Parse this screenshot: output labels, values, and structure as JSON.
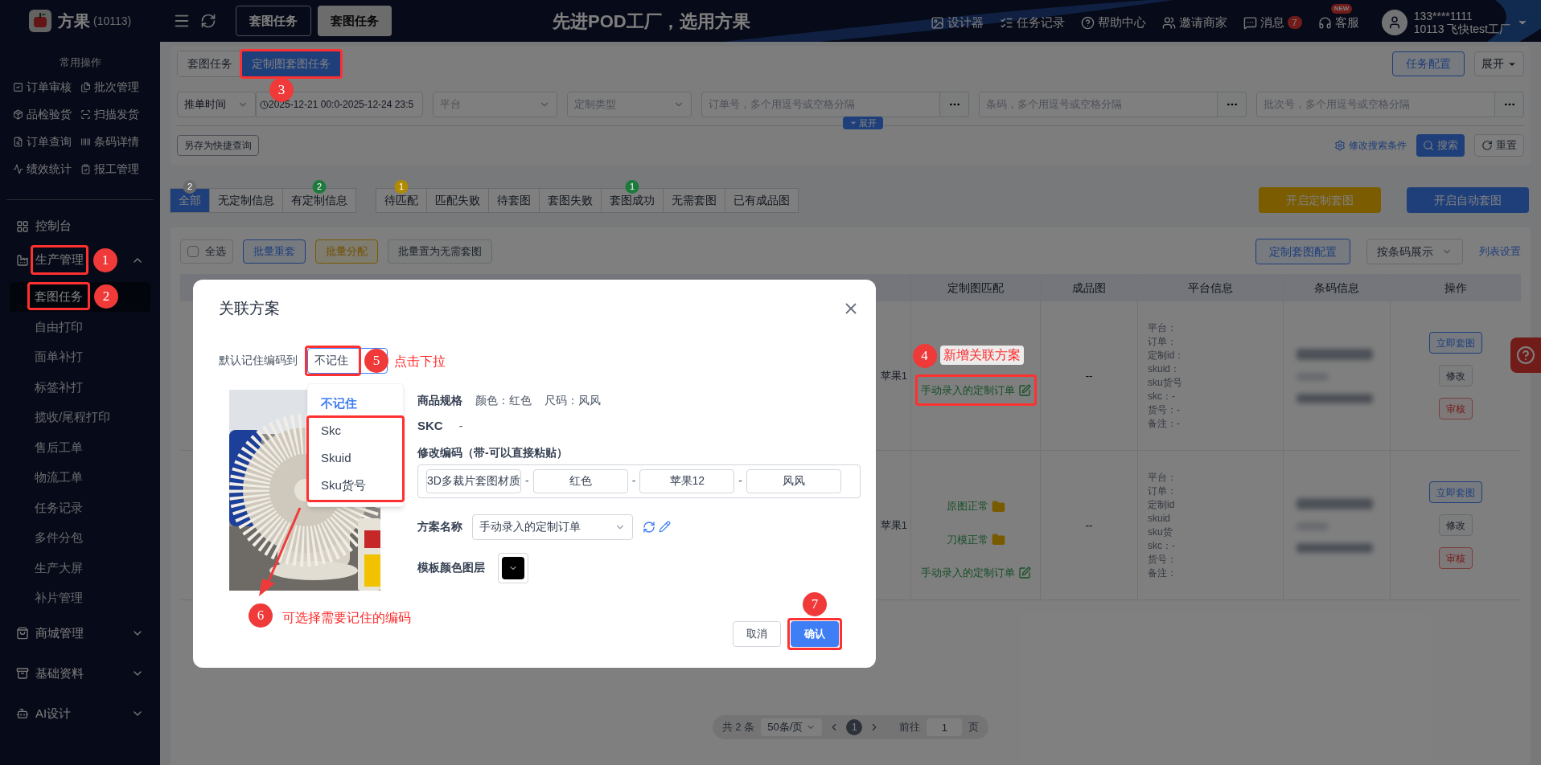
{
  "topbar": {
    "logo": {
      "name": "方果",
      "code": "(10113)"
    },
    "tabs": [
      {
        "label": "套图任务",
        "selected": false
      },
      {
        "label": "套图任务",
        "selected": true
      }
    ],
    "slogan": "先进POD工厂，选用方果",
    "links": [
      {
        "label": "设计器"
      },
      {
        "label": "任务记录",
        "kind": "list"
      },
      {
        "label": "帮助中心",
        "kind": "help"
      },
      {
        "label": "邀请商家",
        "kind": "users"
      },
      {
        "label": "消息",
        "kind": "message",
        "badge": "7"
      },
      {
        "label": "客服",
        "kind": "service",
        "tag": "NEW"
      }
    ],
    "user": {
      "phone": "133****1111",
      "org": "10113 飞快test工厂"
    }
  },
  "sidebar": {
    "quick_title": "常用操作",
    "quick": [
      {
        "label": "订单审核",
        "kind": "check"
      },
      {
        "label": "批次管理",
        "kind": "batch"
      },
      {
        "label": "品检验货",
        "kind": "inspect"
      },
      {
        "label": "扫描发货",
        "kind": "scan"
      },
      {
        "label": "订单查询",
        "kind": "query"
      },
      {
        "label": "条码详情",
        "kind": "barcode"
      },
      {
        "label": "绩效统计",
        "kind": "stats"
      },
      {
        "label": "报工管理",
        "kind": "report"
      }
    ],
    "menu": [
      {
        "label": "控制台",
        "kind": "dashboard"
      },
      {
        "label": "生产管理",
        "kind": "factory",
        "expanded": true,
        "children": [
          {
            "label": "套图任务",
            "selected": true
          },
          {
            "label": "自由打印",
            "selected": false
          },
          {
            "label": "面单补打",
            "selected": false
          },
          {
            "label": "标签补打",
            "selected": false
          },
          {
            "label": "揽收/尾程打印",
            "selected": false
          },
          {
            "label": "售后工单",
            "selected": false
          },
          {
            "label": "物流工单",
            "selected": false
          },
          {
            "label": "任务记录",
            "selected": false
          },
          {
            "label": "多件分包",
            "selected": false
          },
          {
            "label": "生产大屏",
            "selected": false
          },
          {
            "label": "补片管理",
            "selected": false
          }
        ]
      },
      {
        "label": "商城管理",
        "kind": "shop",
        "expanded": false
      },
      {
        "label": "基础资料",
        "kind": "archive",
        "expanded": false
      },
      {
        "label": "AI设计",
        "kind": "ai",
        "expanded": false
      }
    ]
  },
  "page_tabs": [
    {
      "label": "套图任务",
      "selected": false
    },
    {
      "label": "定制图套图任务",
      "selected": true
    }
  ],
  "config_button": "任务配置",
  "expand_button": "展开",
  "filters": [
    {
      "kind": "select",
      "value": "推单时间"
    },
    {
      "kind": "daterange",
      "start": "2025-12-21 00:0",
      "separator": "-",
      "end": "2025-12-24 23:5"
    },
    {
      "kind": "select",
      "placeholder": "平台"
    },
    {
      "kind": "select",
      "placeholder": "定制类型"
    },
    {
      "kind": "multi",
      "placeholder": "订单号，多个用逗号或空格分隔"
    },
    {
      "kind": "multi",
      "placeholder": "条码，多个用逗号或空格分隔"
    },
    {
      "kind": "multi",
      "placeholder": "批次号，多个用逗号或空格分隔"
    }
  ],
  "save_query": "另存为快捷查询",
  "expand_tag": "展开",
  "edit_conditions": "修改搜索条件",
  "search": "搜索",
  "reset": "重置",
  "status_groups": [
    {
      "tabs": [
        {
          "label": "全部",
          "selected": true,
          "badge": "2",
          "color": "#6b6b6b"
        },
        {
          "label": "无定制信息",
          "selected": false
        },
        {
          "label": "有定制信息",
          "selected": false,
          "badge": "2",
          "color": "#1d7a3c"
        }
      ]
    },
    {
      "tabs": [
        {
          "label": "待匹配",
          "selected": false,
          "badge": "1",
          "color": "#b08a00"
        },
        {
          "label": "匹配失败",
          "selected": false
        },
        {
          "label": "待套图",
          "selected": false
        },
        {
          "label": "套图失败",
          "selected": false
        },
        {
          "label": "套图成功",
          "selected": false,
          "badge": "1",
          "color": "#1d7a3c"
        },
        {
          "label": "无需套图",
          "selected": false
        },
        {
          "label": "已有成品图",
          "selected": false
        }
      ]
    }
  ],
  "actions": [
    {
      "label": "开启定制套图",
      "kind": "warning"
    },
    {
      "label": "开启自动套图",
      "kind": "primary"
    }
  ],
  "toolbar": {
    "select_all": {
      "label": "全选",
      "checked": false
    },
    "batch": [
      {
        "label": "批量重套",
        "kind": "primary"
      },
      {
        "label": "批量分配",
        "kind": "warning"
      },
      {
        "label": "批量置为无需套图",
        "kind": "default"
      }
    ],
    "config": "定制套图配置",
    "view": "按条码展示",
    "columns_link": "列表设置"
  },
  "table": {
    "columns": [
      "定制图匹配",
      "成品图",
      "平台信息",
      "条码信息",
      "操作"
    ],
    "rows": [
      {
        "code_tail": "苹果1",
        "matches": [
          {
            "label": "手动录入的定制订单",
            "kind": "edit"
          }
        ],
        "product_image": "--",
        "platform": [
          "平台：",
          "订单：",
          "定制id：",
          "skuid：",
          "sku货号",
          "skc：-",
          "货号：-",
          "备注：-"
        ],
        "actions": [
          {
            "label": "立即套图",
            "kind": "primary"
          },
          {
            "label": "修改",
            "kind": "default"
          },
          {
            "label": "审核",
            "kind": "danger"
          }
        ]
      },
      {
        "code_tail": "苹果1",
        "matches": [
          {
            "label": "原图正常",
            "kind": "folder"
          },
          {
            "label": "刀模正常",
            "kind": "folder"
          },
          {
            "label": "手动录入的定制订单",
            "kind": "edit"
          }
        ],
        "product_image": "--",
        "platform": [
          "平台：",
          "订单：",
          "定制id",
          "skuid",
          "sku货",
          "skc：-",
          "货号：",
          "备注："
        ],
        "actions": [
          {
            "label": "立即套图",
            "kind": "primary"
          },
          {
            "label": "修改",
            "kind": "default"
          },
          {
            "label": "审核",
            "kind": "danger"
          }
        ]
      }
    ]
  },
  "pagination": {
    "total": "共 2 条",
    "page_size": "50条/页",
    "pages": [
      {
        "label": "1",
        "selected": true
      }
    ],
    "goto_label": "前往",
    "goto_value": "1",
    "goto_suffix": "页"
  },
  "modal": {
    "title": "关联方案",
    "remember_label": "默认记住编码到",
    "remember_value": "不记住",
    "options": [
      {
        "label": "不记住",
        "selected": true
      },
      {
        "label": "Skc",
        "selected": false
      },
      {
        "label": "Skuid",
        "selected": false
      },
      {
        "label": "Sku货号",
        "selected": false
      }
    ],
    "spec_label": "商品规格",
    "spec": [
      "颜色：红色",
      "尺码：风风"
    ],
    "skc_label": "SKC",
    "skc_value": "-",
    "code_label": "修改编码（带-可以直接粘贴）",
    "code_segments": [
      {
        "kind": "input",
        "value": "3D多裁片套图材质"
      },
      {
        "kind": "separator",
        "text": "-"
      },
      {
        "kind": "input",
        "value": "红色"
      },
      {
        "kind": "separator",
        "text": "-"
      },
      {
        "kind": "input",
        "value": "苹果12"
      },
      {
        "kind": "separator",
        "text": "-"
      },
      {
        "kind": "input",
        "value": "风风"
      }
    ],
    "scheme_label": "方案名称",
    "scheme_value": "手动录入的定制订单",
    "color_layer_label": "模板颜色图层",
    "color_layer": {
      "color": "#000000"
    },
    "buttons": [
      {
        "label": "取消",
        "kind": "default"
      },
      {
        "label": "确认",
        "kind": "primary"
      }
    ]
  },
  "annotations": [
    {
      "number": "1"
    },
    {
      "number": "2"
    },
    {
      "number": "3"
    },
    {
      "number": "4",
      "note": "新增关联方案"
    },
    {
      "number": "5",
      "note": "点击下拉"
    },
    {
      "number": "6",
      "note": "可选择需要记住的编码"
    },
    {
      "number": "7"
    }
  ]
}
